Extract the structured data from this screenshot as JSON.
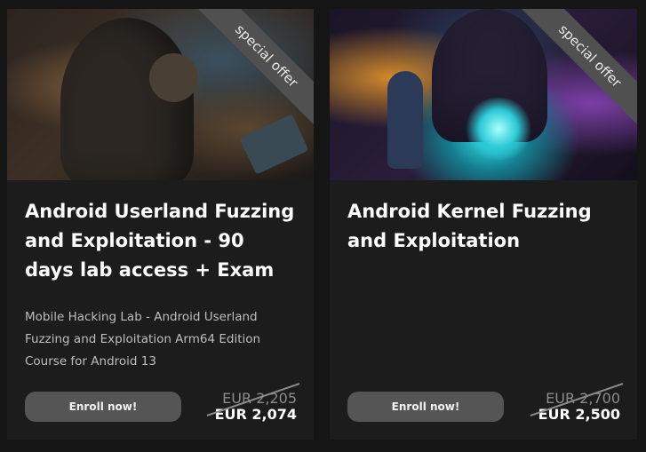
{
  "courses": [
    {
      "ribbon": "special offer",
      "title": "Android Userland Fuzzing and Exploitation - 90 days lab access + Exam",
      "description": "Mobile Hacking Lab - Android Userland Fuzzing and Exploitation Arm64 Edition Course for Android 13",
      "button": "Enroll now!",
      "price_old": "EUR 2,205",
      "price_new": "EUR 2,074"
    },
    {
      "ribbon": "special offer",
      "title": "Android Kernel Fuzzing and Exploitation",
      "description": "",
      "button": "Enroll now!",
      "price_old": "EUR 2,700",
      "price_new": "EUR 2,500"
    }
  ]
}
